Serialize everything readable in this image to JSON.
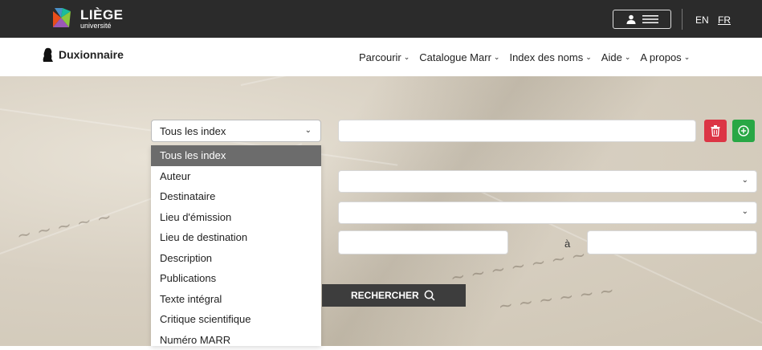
{
  "topbar": {
    "logo_big": "LIÈGE",
    "logo_small": "université",
    "lang_en": "EN",
    "lang_fr": "FR"
  },
  "navbar": {
    "brand": "Duxionnaire",
    "items": [
      {
        "label": "Parcourir"
      },
      {
        "label": "Catalogue Marr"
      },
      {
        "label": "Index des noms"
      },
      {
        "label": "Aide"
      },
      {
        "label": "A propos"
      }
    ]
  },
  "search": {
    "select_value": "Tous les index",
    "options": [
      "Tous les index",
      "Auteur",
      "Destinataire",
      "Lieu d'émission",
      "Lieu de destination",
      "Description",
      "Publications",
      "Texte intégral",
      "Critique scientifique",
      "Numéro MARR"
    ],
    "range_sep": "à",
    "button_label": "RECHERCHER"
  },
  "colors": {
    "topbar": "#2b2b2b",
    "delete": "#dc3545",
    "add": "#28a745",
    "search_button": "#3d3d3d",
    "selected_option": "#6c6c6c"
  },
  "icons": [
    "user-icon",
    "menu-icon",
    "silhouette-icon",
    "chevron-down-icon",
    "trash-icon",
    "plus-circle-icon",
    "search-icon"
  ]
}
